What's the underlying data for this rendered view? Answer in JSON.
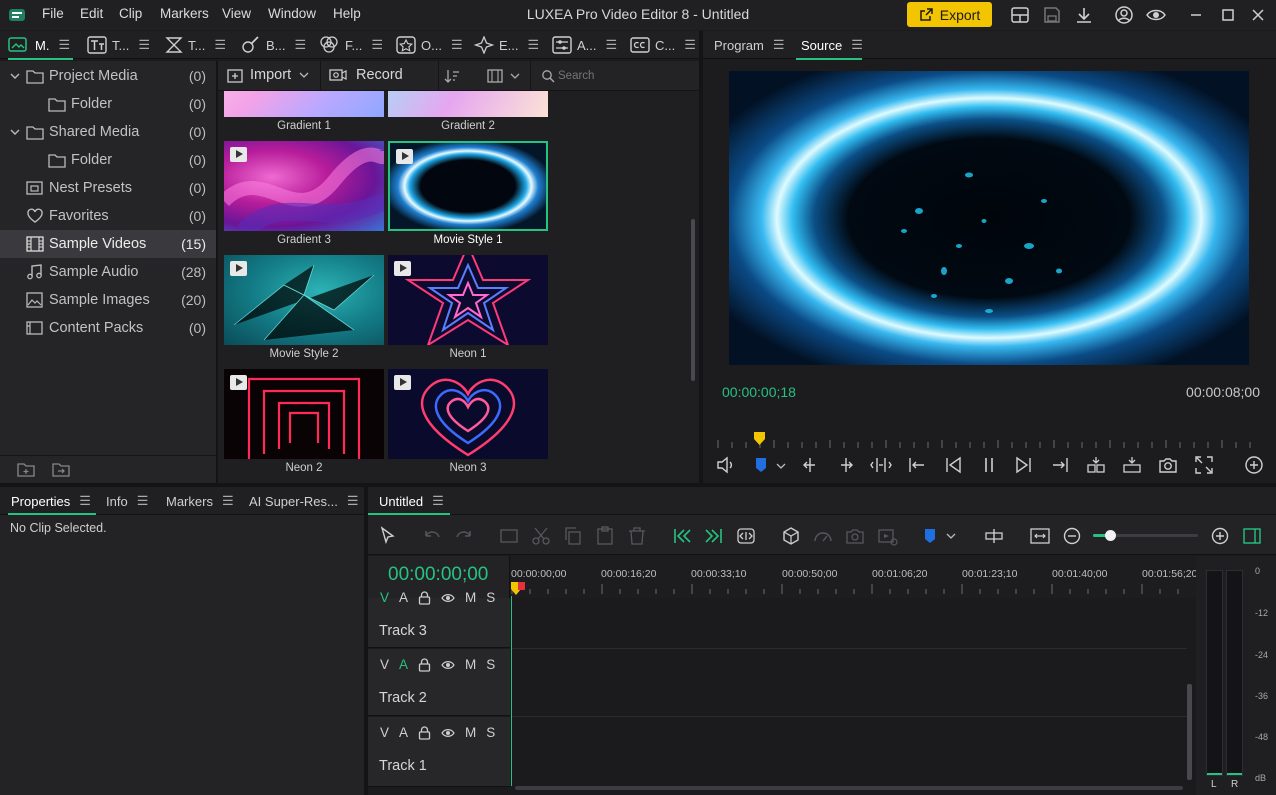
{
  "app": {
    "title": "LUXEA Pro Video Editor 8 - Untitled"
  },
  "menu": [
    "File",
    "Edit",
    "Clip",
    "Markers",
    "View",
    "Window",
    "Help"
  ],
  "toolbar": {
    "export_label": "Export"
  },
  "library_tabs": [
    "M.",
    "T...",
    "T...",
    "B...",
    "F...",
    "O...",
    "E...",
    "A...",
    "C..."
  ],
  "library": {
    "import_label": "Import",
    "record_label": "Record",
    "search_placeholder": "Search",
    "tree": [
      {
        "label": "Project Media",
        "count": "(0)"
      },
      {
        "label": "Folder",
        "count": "(0)"
      },
      {
        "label": "Shared Media",
        "count": "(0)"
      },
      {
        "label": "Folder",
        "count": "(0)"
      },
      {
        "label": "Nest Presets",
        "count": "(0)"
      },
      {
        "label": "Favorites",
        "count": "(0)"
      },
      {
        "label": "Sample Videos",
        "count": "(15)"
      },
      {
        "label": "Sample Audio",
        "count": "(28)"
      },
      {
        "label": "Sample Images",
        "count": "(20)"
      },
      {
        "label": "Content Packs",
        "count": "(0)"
      }
    ],
    "thumbs": [
      "Gradient 1",
      "Gradient 2",
      "Gradient 3",
      "Movie Style 1",
      "Movie Style 2",
      "Neon 1",
      "Neon 2",
      "Neon 3"
    ]
  },
  "viewer": {
    "tabs": [
      "Program",
      "Source"
    ],
    "current_time": "00:00:00;18",
    "duration": "00:00:08;00"
  },
  "bottom_tabs": [
    "Properties",
    "Info",
    "Markers",
    "AI Super-Res..."
  ],
  "properties": {
    "empty": "No Clip Selected."
  },
  "timeline": {
    "tab": "Untitled",
    "timecode": "00:00:00;00",
    "ruler": [
      "00:00:00;00",
      "00:00:16;20",
      "00:00:33;10",
      "00:00:50;00",
      "00:01:06;20",
      "00:01:23;10",
      "00:01:40;00",
      "00:01:56;20"
    ],
    "flags": [
      "V",
      "A",
      "M",
      "S"
    ],
    "tracks": [
      "Track 3",
      "Track 2",
      "Track 1"
    ]
  },
  "meter": {
    "db": [
      "0",
      "-12",
      "-24",
      "-36",
      "-48",
      "dB"
    ],
    "channels": [
      "L",
      "R"
    ]
  },
  "colors": {
    "accent": "#26c281",
    "export": "#f3c400",
    "marker": "#1f6fe0"
  }
}
